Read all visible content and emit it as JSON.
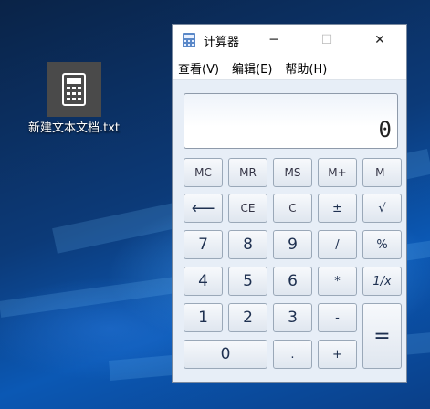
{
  "desktop_icon": {
    "label": "新建文本文档.txt"
  },
  "window": {
    "title": "计算器",
    "minimize": "─",
    "maximize": "☐",
    "close": "✕"
  },
  "menu": [
    "查看(V)",
    "编辑(E)",
    "帮助(H)"
  ],
  "display": {
    "value": "0"
  },
  "buttons": {
    "mc": "MC",
    "mr": "MR",
    "ms": "MS",
    "mplus": "M+",
    "mminus": "M-",
    "backspace": "⟵",
    "ce": "CE",
    "c": "C",
    "plusminus": "±",
    "sqrt": "√",
    "n7": "7",
    "n8": "8",
    "n9": "9",
    "div": "/",
    "pct": "%",
    "n4": "4",
    "n5": "5",
    "n6": "6",
    "mul": "*",
    "recip": "1/x",
    "n1": "1",
    "n2": "2",
    "n3": "3",
    "sub": "-",
    "eq": "=",
    "n0": "0",
    "dot": ".",
    "add": "+"
  }
}
